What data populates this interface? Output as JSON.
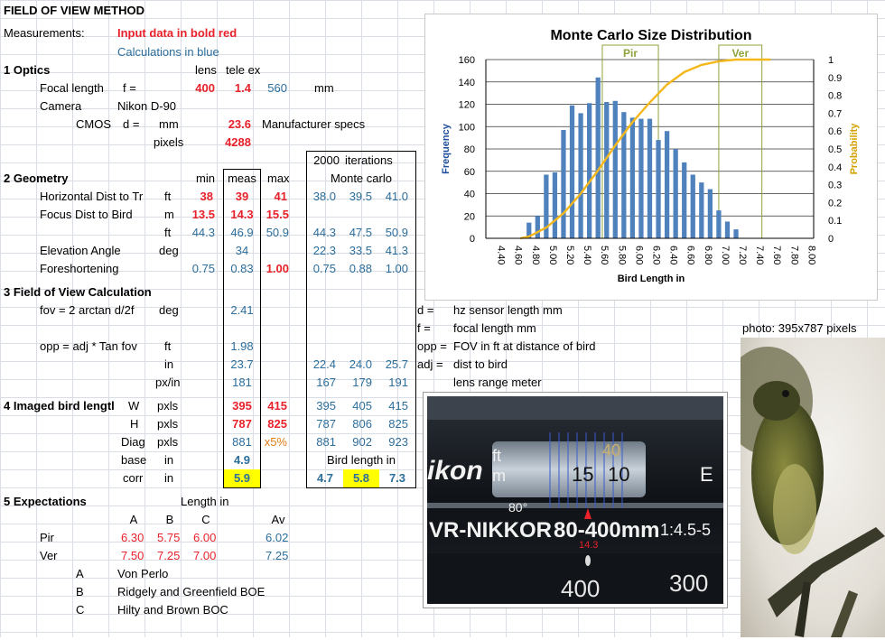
{
  "title": "FIELD OF VIEW METHOD",
  "measurements_label": "Measurements:",
  "legend_input": "Input data in bold red",
  "legend_calc": "Calculations in blue",
  "optics": {
    "heading": "1 Optics",
    "col_lens": "lens",
    "col_tele": "tele ex",
    "focal_label": "Focal length",
    "focal_sym": "f =",
    "focal_lens": "400",
    "focal_tele": "1.4",
    "focal_total": "560",
    "focal_unit": "mm",
    "camera_label": "Camera",
    "camera_value": "Nikon D-90",
    "cmos_label": "CMOS",
    "cmos_sym": "d =",
    "cmos_unit": "mm",
    "cmos_value": "23.6",
    "cmos_note": "Manufacturer specs",
    "pixels_label": "pixels",
    "pixels_value": "4288"
  },
  "mc_header": {
    "iterations": "2000",
    "iterations_label": "iterations",
    "title": "Monte carlo"
  },
  "geometry": {
    "heading": "2 Geometry",
    "col_min": "min",
    "col_meas": "meas",
    "col_max": "max",
    "rows": [
      {
        "label": "Horizontal Dist to Tr",
        "unit": "ft",
        "min": "38",
        "meas": "39",
        "max": "41",
        "mc": [
          "38.0",
          "39.5",
          "41.0"
        ],
        "style": "red"
      },
      {
        "label": "Focus Dist to Bird",
        "unit": "m",
        "min": "13.5",
        "meas": "14.3",
        "max": "15.5",
        "mc": [],
        "style": "red"
      },
      {
        "label": "",
        "unit": "ft",
        "min": "44.3",
        "meas": "46.9",
        "max": "50.9",
        "mc": [
          "44.3",
          "47.5",
          "50.9"
        ],
        "style": "blue"
      },
      {
        "label": "Elevation Angle",
        "unit": "deg",
        "min": "",
        "meas": "34",
        "max": "",
        "mc": [
          "22.3",
          "33.5",
          "41.3"
        ],
        "style": "blue"
      },
      {
        "label": "Foreshortening",
        "unit": "",
        "min": "0.75",
        "meas": "0.83",
        "max": "1.00",
        "mc": [
          "0.75",
          "0.88",
          "1.00"
        ],
        "style": "blue"
      }
    ]
  },
  "fov": {
    "heading": "3 Field of View Calculation",
    "fov_label": "fov = 2 arctan  d/2f",
    "fov_unit": "deg",
    "fov_value": "2.41",
    "opp_label": "opp = adj * Tan fov",
    "opp_unit_ft": "ft",
    "opp_ft": "1.98",
    "opp_unit_in": "in",
    "opp_in": "23.7",
    "opp_in_mc": [
      "22.4",
      "24.0",
      "25.7"
    ],
    "pxin_unit": "px/in",
    "pxin": "181",
    "pxin_mc": [
      "167",
      "179",
      "191"
    ]
  },
  "imaged": {
    "heading": "4 Imaged bird lengtl",
    "w_label": "W",
    "w_unit": "pxls",
    "w_meas": "395",
    "w_max": "415",
    "w_mc": [
      "395",
      "405",
      "415"
    ],
    "h_label": "H",
    "h_unit": "pxls",
    "h_meas": "787",
    "h_max": "825",
    "h_mc": [
      "787",
      "806",
      "825"
    ],
    "diag_label": "Diag",
    "diag_unit": "pxls",
    "diag_meas": "881",
    "diag_max": "x5%",
    "diag_mc": [
      "881",
      "902",
      "923"
    ],
    "base_label": "base",
    "base_unit": "in",
    "base_meas": "4.9",
    "bird_len_label": "Bird length in",
    "corr_label": "corr",
    "corr_unit": "in",
    "corr_meas": "5.9",
    "corr_mc": [
      "4.7",
      "5.8",
      "7.3"
    ]
  },
  "expect": {
    "heading": "5 Expectations",
    "length_label": "Length in",
    "cols": [
      "A",
      "B",
      "C",
      "Av"
    ],
    "rows": [
      {
        "name": "Pir",
        "vals": [
          "6.30",
          "5.75",
          "6.00"
        ],
        "av": "6.02"
      },
      {
        "name": "Ver",
        "vals": [
          "7.50",
          "7.25",
          "7.00"
        ],
        "av": "7.25"
      }
    ],
    "refs": [
      {
        "key": "A",
        "text": "Von Perlo"
      },
      {
        "key": "B",
        "text": "Ridgely and Greenfield BOE"
      },
      {
        "key": "C",
        "text": "Hilty and Brown BOC"
      }
    ]
  },
  "defs": [
    {
      "key": "d =",
      "text": "hz sensor length mm"
    },
    {
      "key": "f =",
      "text": "focal length mm"
    },
    {
      "key": "opp =",
      "text": "FOV in ft at distance of bird"
    },
    {
      "key": "adj =",
      "text": "dist to bird"
    },
    {
      "key": "",
      "text": "lens range meter"
    }
  ],
  "photo_caption": "photo: 395x787 pixels",
  "lens_image": {
    "brand_text": "ikon",
    "model_text": "VR-NIKKOR",
    "zoom_text": "80-400mm",
    "aperture_text": "1:4.5-5",
    "marker_80": "80°",
    "ft_label": "ft",
    "m_label": "m",
    "dist_15": "15",
    "dist_10": "10",
    "dist_40": "40",
    "zoom_400": "400",
    "zoom_300": "300",
    "focus_mark": "14.3",
    "e_text": "E"
  },
  "colors": {
    "input_red": "#e8212a",
    "calc_blue": "#2c6e9c",
    "bar_blue": "#4f81bd",
    "curve_gold": "#f4b81c",
    "highlight_yellow": "#ffff00",
    "species_green": "#8ea33c"
  },
  "chart_data": {
    "type": "bar",
    "title": "Monte Carlo Size Distribution",
    "xlabel": "Bird Length  in",
    "ylabel": "Frequency",
    "y2label": "Probability",
    "ylim": [
      0,
      160
    ],
    "yticks": [
      0,
      20,
      40,
      60,
      80,
      100,
      120,
      140,
      160
    ],
    "y2lim": [
      0,
      1
    ],
    "y2ticks": [
      "0",
      "0.1",
      "0.2",
      "0.3",
      "0.4",
      "0.5",
      "0.6",
      "0.7",
      "0.8",
      "0.9",
      "1"
    ],
    "categories": [
      "4.40",
      "4.60",
      "4.80",
      "5.00",
      "5.20",
      "5.40",
      "5.60",
      "5.80",
      "6.00",
      "6.20",
      "6.40",
      "6.60",
      "6.80",
      "7.00",
      "7.20",
      "7.40",
      "7.60",
      "7.80",
      "8.00"
    ],
    "bars_x": [
      4.8,
      4.9,
      5.0,
      5.1,
      5.2,
      5.3,
      5.4,
      5.5,
      5.6,
      5.7,
      5.8,
      5.9,
      6.0,
      6.1,
      6.2,
      6.3,
      6.4,
      6.5,
      6.6,
      6.7,
      6.8,
      6.9,
      7.0,
      7.1,
      7.2
    ],
    "series": [
      {
        "name": "Frequency",
        "values": [
          14,
          20,
          57,
          59,
          97,
          119,
          112,
          121,
          144,
          122,
          123,
          113,
          108,
          107,
          107,
          88,
          96,
          80,
          68,
          57,
          50,
          44,
          25,
          15,
          8
        ]
      }
    ],
    "cdf": {
      "name": "Probability",
      "x": [
        4.7,
        4.8,
        5.0,
        5.2,
        5.4,
        5.6,
        5.8,
        6.0,
        6.2,
        6.4,
        6.6,
        6.8,
        7.0,
        7.2,
        7.3
      ],
      "y": [
        0,
        0.01,
        0.06,
        0.14,
        0.25,
        0.38,
        0.52,
        0.65,
        0.76,
        0.86,
        0.93,
        0.97,
        0.99,
        1.0,
        1.0
      ]
    },
    "bands": [
      {
        "name": "Pir",
        "from": 5.65,
        "to": 6.3
      },
      {
        "name": "Ver",
        "from": 7.0,
        "to": 7.5
      }
    ]
  }
}
